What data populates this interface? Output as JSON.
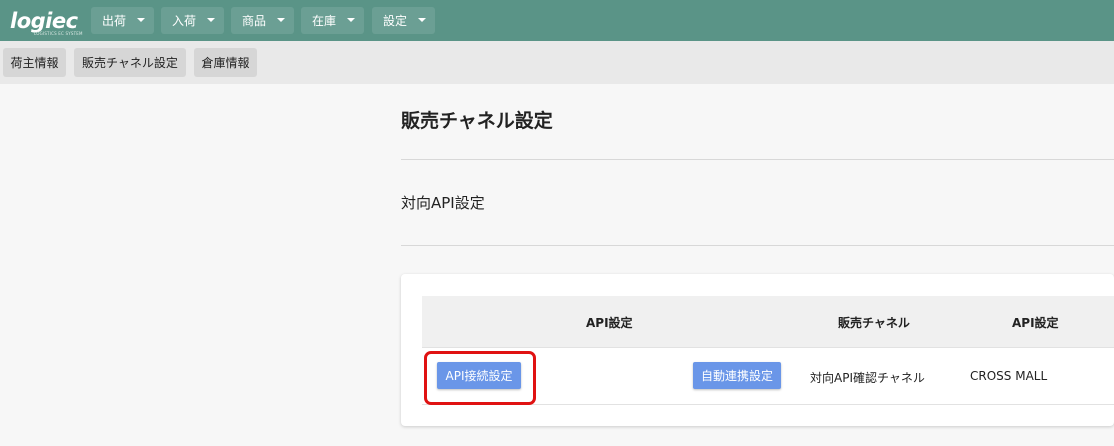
{
  "header": {
    "logo_text": "logiec",
    "logo_sub": "LOGISTICS EC SYSTEM",
    "menus": [
      {
        "label": "出荷"
      },
      {
        "label": "入荷"
      },
      {
        "label": "商品"
      },
      {
        "label": "在庫"
      },
      {
        "label": "設定"
      }
    ],
    "colors": {
      "bar": "#5a9487",
      "menu": "#6b9f94"
    }
  },
  "subnav": {
    "items": [
      {
        "label": "荷主情報"
      },
      {
        "label": "販売チャネル設定"
      },
      {
        "label": "倉庫情報"
      }
    ]
  },
  "page": {
    "title": "販売チャネル設定",
    "section_title": "対向API設定"
  },
  "table": {
    "headers": [
      "API設定",
      "販売チャネル",
      "API設定"
    ],
    "rows": [
      {
        "api_connect_button": "API接続設定",
        "auto_link_button": "自動連携設定",
        "channel": "対向API確認チャネル",
        "api": "CROSS MALL"
      }
    ],
    "colors": {
      "button": "#6a96e8",
      "highlight": "#e01212"
    }
  }
}
